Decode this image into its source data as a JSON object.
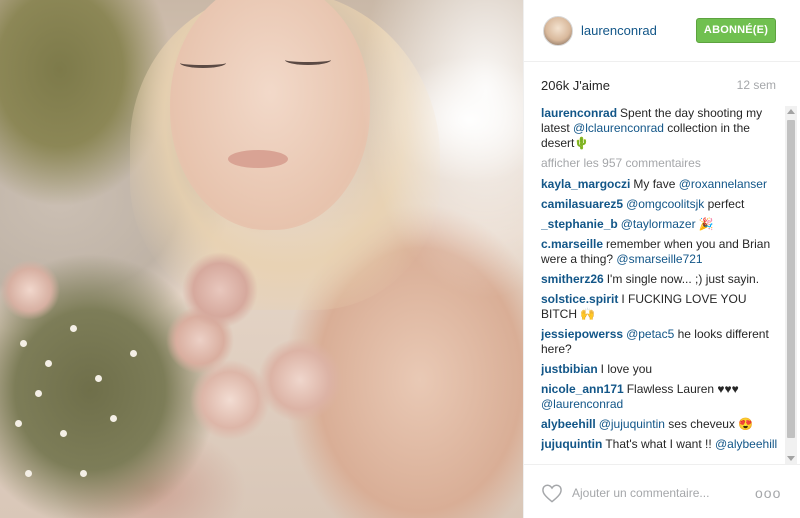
{
  "post": {
    "image_alt": "Photo of woman holding a flower bouquet in the desert"
  },
  "header": {
    "username": "laurenconrad",
    "follow_label": "ABONNÉ(E)"
  },
  "stats": {
    "likes": "206k J'aime",
    "time": "12 sem"
  },
  "caption": {
    "username": "laurenconrad",
    "text_1": "Spent the day shooting my latest ",
    "mention": "@lclaurenconrad",
    "text_2": " collection in the desert",
    "emoji": "🌵"
  },
  "more_comments": "afficher les 957 commentaires",
  "comments": [
    {
      "user": "kayla_margoczi",
      "text": "My fave ",
      "mention": "@roxannelanser",
      "tail": ""
    },
    {
      "user": "camilasuarez5",
      "text": "",
      "mention": "@omgcoolitsjk",
      "tail": " perfect"
    },
    {
      "user": "_stephanie_b",
      "text": "",
      "mention": "@taylormazer",
      "tail": " 🎉"
    },
    {
      "user": "c.marseille",
      "text": "remember when you and Brian were a thing? ",
      "mention": "@smarseille721",
      "tail": ""
    },
    {
      "user": "smitherz26",
      "text": "I'm single now... ;) just sayin.",
      "mention": "",
      "tail": ""
    },
    {
      "user": "solstice.spirit",
      "text": "I FUCKING LOVE YOU BITCH 🙌",
      "mention": "",
      "tail": ""
    },
    {
      "user": "jessiepowerss",
      "text": "",
      "mention": "@petac5",
      "tail": " he looks different here?"
    },
    {
      "user": "justbibian",
      "text": "I love you",
      "mention": "",
      "tail": ""
    },
    {
      "user": "nicole_ann171",
      "text": "Flawless Lauren ♥♥♥ ",
      "mention": "@laurenconrad",
      "tail": ""
    },
    {
      "user": "alybeehill",
      "text": "",
      "mention": "@jujuquintin",
      "tail": " ses cheveux 😍"
    },
    {
      "user": "jujuquintin",
      "text": "That's what I want !! ",
      "mention": "@alybeehill",
      "tail": ""
    }
  ],
  "footer": {
    "comment_placeholder": "Ajouter un commentaire...",
    "more_label": "ooo"
  },
  "colors": {
    "link": "#125688",
    "follow_bg": "#70c050",
    "muted": "#a5a7aa"
  },
  "icons": [
    "heart-icon",
    "more-options-icon",
    "avatar"
  ]
}
